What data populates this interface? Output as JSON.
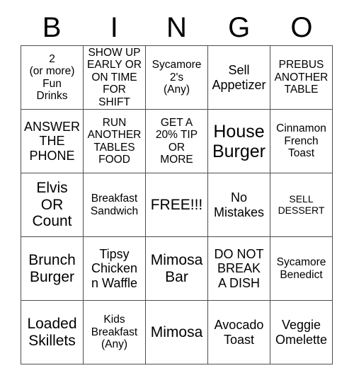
{
  "card": {
    "title": "BINGO",
    "header_letters": [
      "B",
      "I",
      "N",
      "G",
      "O"
    ],
    "free_space_label": "FREE!!!",
    "colors": {
      "border": "#4d4d4d",
      "background": "#ffffff",
      "text": "#000000"
    },
    "rows": [
      [
        {
          "text": "2\n(or more)\nFun\nDrinks",
          "size": "sm"
        },
        {
          "text": "SHOW UP\nEARLY OR\nON TIME\nFOR SHIFT",
          "size": "sm"
        },
        {
          "text": "Sycamore\n2's\n(Any)",
          "size": "sm"
        },
        {
          "text": "Sell\nAppetizer",
          "size": "md"
        },
        {
          "text": "PREBUS\nANOTHER\nTABLE",
          "size": "sm"
        }
      ],
      [
        {
          "text": "ANSWER\nTHE\nPHONE",
          "size": "md"
        },
        {
          "text": "RUN\nANOTHER\nTABLES\nFOOD",
          "size": "sm"
        },
        {
          "text": "GET A\n20% TIP\nOR\nMORE",
          "size": "sm"
        },
        {
          "text": "House\nBurger",
          "size": "xl"
        },
        {
          "text": "Cinnamon\nFrench\nToast",
          "size": "sm"
        }
      ],
      [
        {
          "text": "Elvis\nOR\nCount",
          "size": "lg"
        },
        {
          "text": "Breakfast\nSandwich",
          "size": "sm"
        },
        {
          "text": "FREE!!!",
          "size": "lg"
        },
        {
          "text": "No\nMistakes",
          "size": "md"
        },
        {
          "text": "SELL\nDESSERT",
          "size": "xs"
        }
      ],
      [
        {
          "text": "Brunch\nBurger",
          "size": "lg"
        },
        {
          "text": "Tipsy\nChicken\nn Waffle",
          "size": "md"
        },
        {
          "text": "Mimosa\nBar",
          "size": "lg"
        },
        {
          "text": "DO NOT\nBREAK\nA DISH",
          "size": "md"
        },
        {
          "text": "Sycamore\nBenedict",
          "size": "sm"
        }
      ],
      [
        {
          "text": "Loaded\nSkillets",
          "size": "lg"
        },
        {
          "text": "Kids\nBreakfast\n(Any)",
          "size": "sm"
        },
        {
          "text": "Mimosa",
          "size": "lg"
        },
        {
          "text": "Avocado\nToast",
          "size": "md"
        },
        {
          "text": "Veggie\nOmelette",
          "size": "md"
        }
      ]
    ]
  }
}
